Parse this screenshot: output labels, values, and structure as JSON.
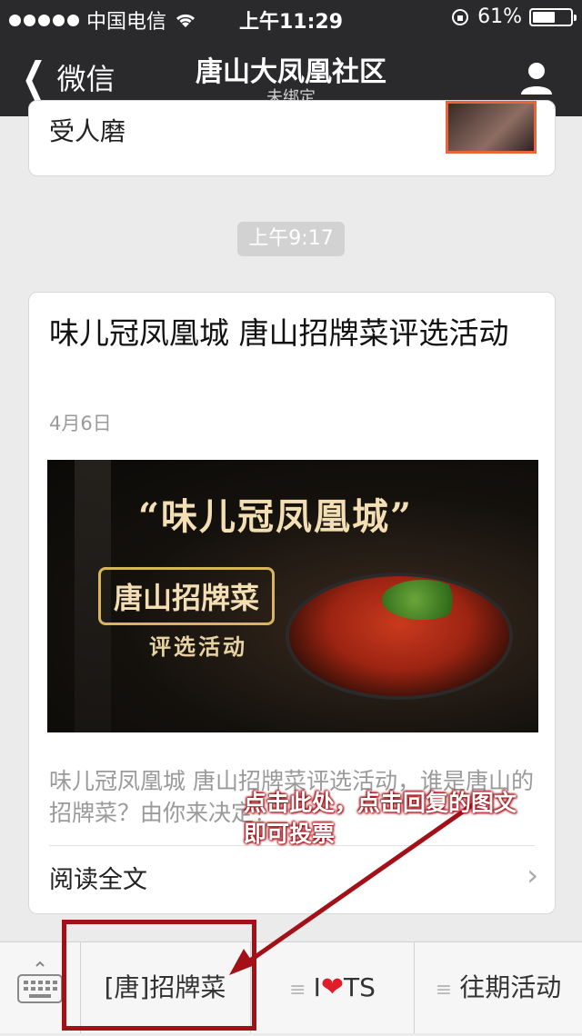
{
  "status_bar": {
    "carrier": "中国电信",
    "time": "上午11:29",
    "battery": "61%",
    "battery_level": 0.61
  },
  "nav": {
    "back_label": "微信",
    "title": "唐山大凤凰社区",
    "subtitle": "未绑定"
  },
  "messages": {
    "prev_card_text": "受人磨",
    "time_badge": "上午9:17",
    "article": {
      "title": "味儿冠凤凰城 唐山招牌菜评选活动",
      "date": "4月6日",
      "banner": {
        "quote": "“味儿冠凤凰城”",
        "stamp": "唐山招牌菜",
        "sub": "评选活动"
      },
      "summary": "味儿冠凤凰城 唐山招牌菜评选活动，谁是唐山的招牌菜？由你来决定！",
      "read_all": "阅读全文"
    }
  },
  "annotation": {
    "line1": "点击此处，点击回复的图文",
    "line2": "即可投票"
  },
  "bottom_menu": {
    "items": [
      {
        "label": "[唐]招牌菜"
      },
      {
        "label_prefix": "I",
        "label_suffix": "TS"
      },
      {
        "label": "往期活动"
      }
    ]
  },
  "colors": {
    "nav_bg": "#2a2a2d",
    "annotation_red": "#a31018",
    "background": "#ebebeb"
  }
}
